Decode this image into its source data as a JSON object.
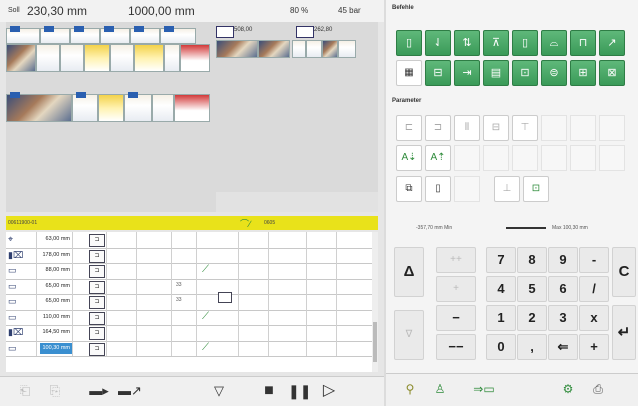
{
  "topbar": {
    "mode_label": "Soll",
    "position_value": "230,30 mm",
    "length_value": "1000,00 mm",
    "zoom": "80 %",
    "pressure": "45 bar"
  },
  "preview": {
    "panel1_label": "508,00",
    "panel2_label": "262,80"
  },
  "yellow_bar": {
    "left_text": "00611900-01",
    "right_text": "0605"
  },
  "table": {
    "rows": [
      {
        "value": "63,00 mm",
        "num": "",
        "selected": false
      },
      {
        "value": "178,00 mm",
        "num": "",
        "selected": false
      },
      {
        "value": "88,00 mm",
        "num": "",
        "selected": false
      },
      {
        "value": "65,00 mm",
        "num": "33",
        "selected": false
      },
      {
        "value": "65,00 mm",
        "num": "33",
        "selected": false
      },
      {
        "value": "110,00 mm",
        "num": "",
        "selected": false
      },
      {
        "value": "164,50 mm",
        "num": "",
        "selected": false
      },
      {
        "value": "100,30 mm",
        "num": "",
        "selected": true
      }
    ]
  },
  "right": {
    "section_befehle": "Befehle",
    "section_parameter": "Parameter",
    "slider_min": "-357,70 mm Min",
    "slider_max": "Max 100,30 mm"
  },
  "keypad": {
    "k7": "7",
    "k8": "8",
    "k9": "9",
    "kminus": "-",
    "k4": "4",
    "k5": "5",
    "k6": "6",
    "kslash": "/",
    "k1": "1",
    "k2": "2",
    "k3": "3",
    "kx": "x",
    "k0": "0",
    "kcomma": ",",
    "kback": "⇐",
    "kplus": "+",
    "kC": "C",
    "kenter": "↵",
    "kdelta": "Δ",
    "kdelta_dis": "∇",
    "kpp": "++",
    "kp": "+",
    "km": "−",
    "kmm": "−−"
  },
  "colors": {
    "green": "#3a9a58",
    "yellow": "#e9e21a",
    "selected_blue": "#3a8fd0"
  }
}
